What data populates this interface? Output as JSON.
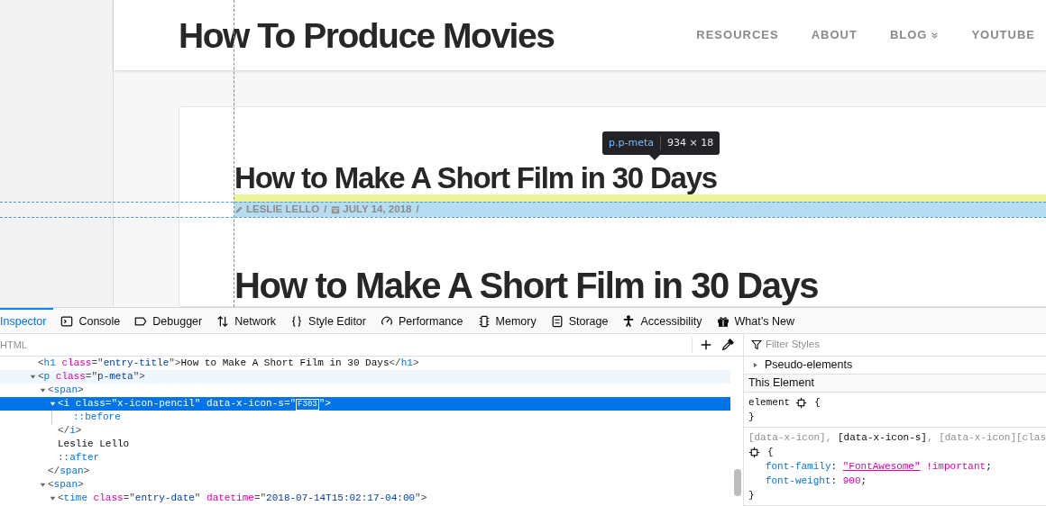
{
  "page": {
    "site_title": "How To Produce Movies",
    "nav": [
      {
        "label": "RESOURCES",
        "dropdown": false
      },
      {
        "label": "ABOUT",
        "dropdown": false
      },
      {
        "label": "BLOG",
        "dropdown": true
      },
      {
        "label": "YOUTUBE",
        "dropdown": false
      }
    ],
    "article": {
      "title": "How to Make A Short Film in 30 Days",
      "highlighted": true,
      "meta": [
        {
          "kind": "author",
          "text": "LESLIE LELLO"
        },
        {
          "kind": "separator",
          "text": "/"
        },
        {
          "kind": "date",
          "text": "JULY 14, 2018"
        },
        {
          "kind": "separator",
          "text": "/"
        }
      ],
      "heading": "How to Make A Short Film in 30 Days"
    },
    "tooltip": {
      "selector": "p.p-meta",
      "size": "934 × 18"
    }
  },
  "devtools": {
    "tabs": [
      {
        "kind": "inspector",
        "label": "Inspector",
        "selected": true
      },
      {
        "kind": "console",
        "label": "Console",
        "selected": false
      },
      {
        "kind": "debugger",
        "label": "Debugger",
        "selected": false
      },
      {
        "kind": "network",
        "label": "Network",
        "selected": false
      },
      {
        "kind": "styleeditor",
        "label": "Style Editor",
        "selected": false
      },
      {
        "kind": "performance",
        "label": "Performance",
        "selected": false
      },
      {
        "kind": "memory",
        "label": "Memory",
        "selected": false
      },
      {
        "kind": "storage",
        "label": "Storage",
        "selected": false
      },
      {
        "kind": "accessibility",
        "label": "Accessibility",
        "selected": false
      },
      {
        "kind": "whatsnew",
        "label": "What’s New",
        "selected": false
      }
    ],
    "markup_label": "HTML",
    "filter": {
      "placeholder": "Filter Styles"
    },
    "tree": [
      {
        "selected": false,
        "hovered": false,
        "line": [
          {
            "kind": "punct",
            "s": "<"
          },
          {
            "kind": "tag",
            "s": "h1"
          },
          {
            "kind": "attr",
            "s": " class"
          },
          {
            "kind": "punct",
            "s": "=\""
          },
          {
            "kind": "value",
            "s": "entry-title"
          },
          {
            "kind": "punct",
            "s": "\">"
          },
          {
            "kind": "text",
            "s": "How to Make A Short Film in 30 Days"
          },
          {
            "kind": "punct",
            "s": "</"
          },
          {
            "kind": "tag",
            "s": "h1"
          },
          {
            "kind": "punct",
            "s": ">"
          }
        ]
      },
      {
        "selected": false,
        "hovered": true,
        "expanded": true,
        "line": [
          {
            "kind": "punct",
            "s": "<"
          },
          {
            "kind": "tag",
            "s": "p"
          },
          {
            "kind": "attr",
            "s": " class"
          },
          {
            "kind": "punct",
            "s": "=\""
          },
          {
            "kind": "value",
            "s": "p-meta"
          },
          {
            "kind": "punct",
            "s": "\">"
          }
        ],
        "children": [
          {
            "selected": false,
            "hovered": false,
            "expanded": true,
            "line": [
              {
                "kind": "punct",
                "s": "<"
              },
              {
                "kind": "tag",
                "s": "span"
              },
              {
                "kind": "punct",
                "s": ">"
              }
            ],
            "children": [
              {
                "selected": true,
                "hovered": false,
                "expanded": true,
                "line": [
                  {
                    "kind": "punct",
                    "s": "<"
                  },
                  {
                    "kind": "tag",
                    "s": "i"
                  },
                  {
                    "kind": "attr",
                    "s": " class"
                  },
                  {
                    "kind": "punct",
                    "s": "=\""
                  },
                  {
                    "kind": "value",
                    "s": "x-icon-pencil"
                  },
                  {
                    "kind": "punct",
                    "s": "\""
                  },
                  {
                    "kind": "attr",
                    "s": " data-x-icon-s"
                  },
                  {
                    "kind": "punct",
                    "s": "=\""
                  },
                  {
                    "kind": "glyph",
                    "s": "F303"
                  },
                  {
                    "kind": "punct",
                    "s": "\">"
                  }
                ],
                "children": [
                  {
                    "selected": false,
                    "hovered": false,
                    "line": [
                      {
                        "kind": "pseudo",
                        "s": "::before"
                      }
                    ]
                  }
                ],
                "close": [
                  {
                    "kind": "punct",
                    "s": "</"
                  },
                  {
                    "kind": "tag",
                    "s": "i"
                  },
                  {
                    "kind": "punct",
                    "s": ">"
                  }
                ]
              },
              {
                "selected": false,
                "hovered": false,
                "line": [
                  {
                    "kind": "text",
                    "s": "Leslie Lello"
                  }
                ]
              },
              {
                "selected": false,
                "hovered": false,
                "line": [
                  {
                    "kind": "pseudo",
                    "s": "::after"
                  }
                ]
              }
            ],
            "close": [
              {
                "kind": "punct",
                "s": "</"
              },
              {
                "kind": "tag",
                "s": "span"
              },
              {
                "kind": "punct",
                "s": ">"
              }
            ]
          },
          {
            "selected": false,
            "hovered": false,
            "expanded": true,
            "line": [
              {
                "kind": "punct",
                "s": "<"
              },
              {
                "kind": "tag",
                "s": "span"
              },
              {
                "kind": "punct",
                "s": ">"
              }
            ],
            "children": [
              {
                "selected": false,
                "hovered": false,
                "expanded": true,
                "line": [
                  {
                    "kind": "punct",
                    "s": "<"
                  },
                  {
                    "kind": "tag",
                    "s": "time"
                  },
                  {
                    "kind": "attr",
                    "s": " class"
                  },
                  {
                    "kind": "punct",
                    "s": "=\""
                  },
                  {
                    "kind": "value",
                    "s": "entry-date"
                  },
                  {
                    "kind": "punct",
                    "s": "\""
                  },
                  {
                    "kind": "attr",
                    "s": " datetime"
                  },
                  {
                    "kind": "punct",
                    "s": "=\""
                  },
                  {
                    "kind": "value",
                    "s": "2018-07-14T15:02:17-04:00"
                  },
                  {
                    "kind": "punct",
                    "s": "\">"
                  }
                ]
              }
            ]
          }
        ]
      }
    ],
    "pseudo": {
      "label": "Pseudo-elements",
      "expanded": false
    },
    "section_header": "This Element",
    "rules": [
      {
        "selectors": [
          {
            "text": "element",
            "matched": true
          }
        ],
        "open": "{",
        "close": "}"
      },
      {
        "selectors": [
          {
            "text": "[data-x-icon], ",
            "matched": false
          },
          {
            "text": "[data-x-icon-s]",
            "matched": true
          },
          {
            "text": ", [data-x-icon][clas",
            "matched": false
          }
        ],
        "open": "{",
        "close": "}",
        "declarations": [
          [
            {
              "kind": "prop",
              "s": "font-family"
            },
            {
              "kind": "punct",
              "s": ": "
            },
            {
              "kind": "link",
              "s": "\"FontAwesome\""
            },
            {
              "kind": "important",
              "s": " !important"
            },
            {
              "kind": "punct",
              "s": ";"
            }
          ],
          [
            {
              "kind": "prop",
              "s": "font-weight"
            },
            {
              "kind": "punct",
              "s": ": "
            },
            {
              "kind": "val",
              "s": "900"
            },
            {
              "kind": "punct",
              "s": ";"
            }
          ]
        ]
      }
    ]
  }
}
